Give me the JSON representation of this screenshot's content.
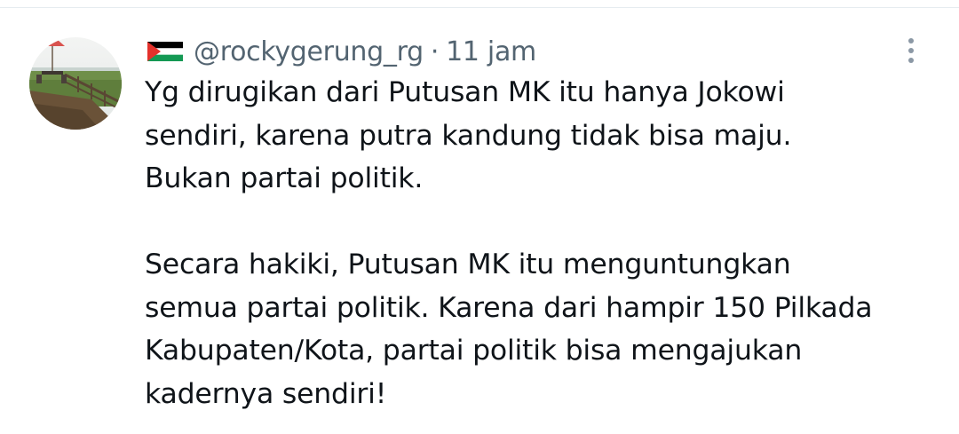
{
  "tweet": {
    "author": {
      "handle": "@rockygerung_rg",
      "flag_icon": "palestine-flag",
      "avatar_icon": "scenic-deck-photo"
    },
    "separator": "·",
    "time": "11 jam",
    "paragraphs": [
      {
        "lines": [
          "Yg dirugikan dari Putusan MK itu hanya Jokowi",
          "sendiri, karena putra kandung tidak bisa maju.",
          "Bukan partai politik."
        ]
      },
      {
        "lines": [
          "Secara hakiki, Putusan MK itu menguntungkan",
          "semua partai politik. Karena dari hampir 150 Pilkada",
          "Kabupaten/Kota, partai politik bisa mengajukan",
          "kadernya sendiri!"
        ]
      }
    ]
  },
  "colors": {
    "text_primary": "#0f1419",
    "text_secondary": "#536471",
    "divider": "#e6ecf0",
    "flag_black": "#000000",
    "flag_white": "#ffffff",
    "flag_green": "#149954",
    "flag_red": "#e4312b"
  }
}
